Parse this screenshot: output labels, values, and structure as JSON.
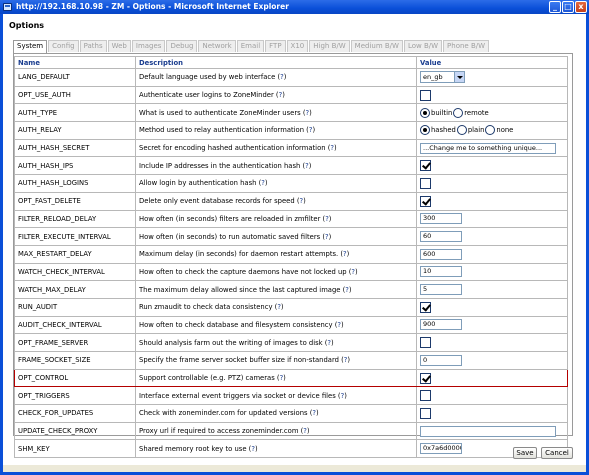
{
  "window": {
    "title": "http://192.168.10.98 - ZM - Options - Microsoft Internet Explorer",
    "minimize": "_",
    "maximize": "□",
    "close": "x"
  },
  "page": {
    "title": "Options"
  },
  "tabs": [
    "System",
    "Config",
    "Paths",
    "Web",
    "Images",
    "Debug",
    "Network",
    "Email",
    "FTP",
    "X10",
    "High B/W",
    "Medium B/W",
    "Low B/W",
    "Phone B/W"
  ],
  "active_tab": "System",
  "table": {
    "headers": {
      "name": "Name",
      "description": "Description",
      "value": "Value"
    },
    "rows": [
      {
        "name": "LANG_DEFAULT",
        "desc": "Default language used by web interface (",
        "q": "?",
        "close": ")",
        "control": "select",
        "value": "en_gb"
      },
      {
        "name": "OPT_USE_AUTH",
        "desc": "Authenticate user logins to ZoneMinder (",
        "q": "?",
        "close": ")",
        "control": "checkbox",
        "checked": false
      },
      {
        "name": "AUTH_TYPE",
        "desc": "What is used to authenticate ZoneMinder users (",
        "q": "?",
        "close": ")",
        "control": "radio",
        "options": [
          {
            "label": "builtin",
            "selected": true
          },
          {
            "label": "remote",
            "selected": false
          }
        ]
      },
      {
        "name": "AUTH_RELAY",
        "desc": "Method used to relay authentication information (",
        "q": "?",
        "close": ")",
        "control": "radio",
        "options": [
          {
            "label": "hashed",
            "selected": true
          },
          {
            "label": "plain",
            "selected": false
          },
          {
            "label": "none",
            "selected": false
          }
        ]
      },
      {
        "name": "AUTH_HASH_SECRET",
        "desc": "Secret for encoding hashed authentication information (",
        "q": "?",
        "close": ")",
        "control": "text",
        "value": "...Change me to something unique...",
        "size": "wide"
      },
      {
        "name": "AUTH_HASH_IPS",
        "desc": "Include IP addresses in the authentication hash (",
        "q": "?",
        "close": ")",
        "control": "checkbox",
        "checked": true
      },
      {
        "name": "AUTH_HASH_LOGINS",
        "desc": "Allow login by authentication hash (",
        "q": "?",
        "close": ")",
        "control": "checkbox",
        "checked": false
      },
      {
        "name": "OPT_FAST_DELETE",
        "desc": "Delete only event database records for speed (",
        "q": "?",
        "close": ")",
        "control": "checkbox",
        "checked": true
      },
      {
        "name": "FILTER_RELOAD_DELAY",
        "desc": "How often (in seconds) filters are reloaded in zmfilter (",
        "q": "?",
        "close": ")",
        "control": "text",
        "value": "300",
        "size": "short"
      },
      {
        "name": "FILTER_EXECUTE_INTERVAL",
        "desc": "How often (in seconds) to run automatic saved filters (",
        "q": "?",
        "close": ")",
        "control": "text",
        "value": "60",
        "size": "short"
      },
      {
        "name": "MAX_RESTART_DELAY",
        "desc": "Maximum delay (in seconds) for daemon restart attempts. (",
        "q": "?",
        "close": ")",
        "control": "text",
        "value": "600",
        "size": "short"
      },
      {
        "name": "WATCH_CHECK_INTERVAL",
        "desc": "How often to check the capture daemons have not locked up (",
        "q": "?",
        "close": ")",
        "control": "text",
        "value": "10",
        "size": "short"
      },
      {
        "name": "WATCH_MAX_DELAY",
        "desc": "The maximum delay allowed since the last captured image (",
        "q": "?",
        "close": ")",
        "control": "text",
        "value": "5",
        "size": "short"
      },
      {
        "name": "RUN_AUDIT",
        "desc": "Run zmaudit to check data consistency (",
        "q": "?",
        "close": ")",
        "control": "checkbox",
        "checked": true
      },
      {
        "name": "AUDIT_CHECK_INTERVAL",
        "desc": "How often to check database and filesystem consistency (",
        "q": "?",
        "close": ")",
        "control": "text",
        "value": "900",
        "size": "short"
      },
      {
        "name": "OPT_FRAME_SERVER",
        "desc": "Should analysis farm out the writing of images to disk (",
        "q": "?",
        "close": ")",
        "control": "checkbox",
        "checked": false
      },
      {
        "name": "FRAME_SOCKET_SIZE",
        "desc": "Specify the frame server socket buffer size if non-standard (",
        "q": "?",
        "close": ")",
        "control": "text",
        "value": "0",
        "size": "short"
      },
      {
        "name": "OPT_CONTROL",
        "desc": "Support controllable (e.g. PTZ) cameras (",
        "q": "?",
        "close": ")",
        "control": "checkbox",
        "checked": true,
        "highlight": true
      },
      {
        "name": "OPT_TRIGGERS",
        "desc": "Interface external event triggers via socket or device files (",
        "q": "?",
        "close": ")",
        "control": "checkbox",
        "checked": false
      },
      {
        "name": "CHECK_FOR_UPDATES",
        "desc": "Check with zoneminder.com for updated versions (",
        "q": "?",
        "close": ")",
        "control": "checkbox",
        "checked": false
      },
      {
        "name": "UPDATE_CHECK_PROXY",
        "desc": "Proxy url if required to access zoneminder.com (",
        "q": "?",
        "close": ")",
        "control": "text",
        "value": "",
        "size": "wide"
      },
      {
        "name": "SHM_KEY",
        "desc": "Shared memory root key to use (",
        "q": "?",
        "close": ")",
        "control": "text",
        "value": "0x7a6d0000",
        "size": "short"
      }
    ]
  },
  "buttons": {
    "save": "Save",
    "cancel": "Cancel"
  }
}
